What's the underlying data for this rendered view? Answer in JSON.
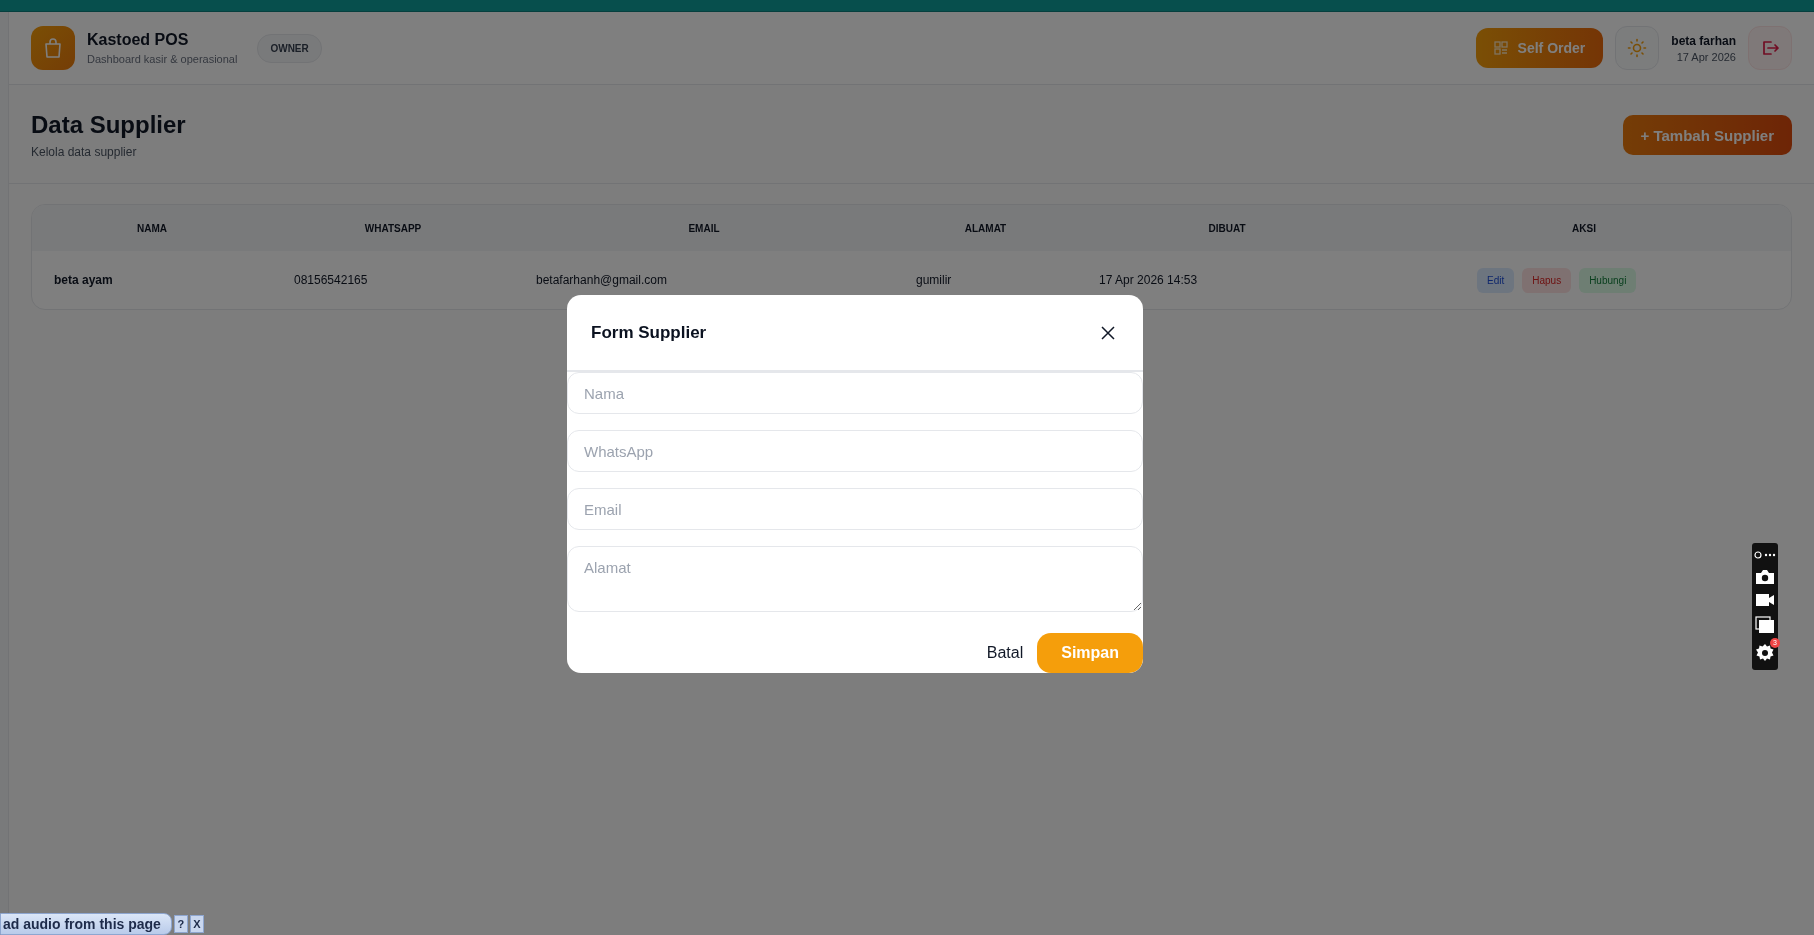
{
  "header": {
    "app_name": "Kastoed POS",
    "subtitle": "Dashboard kasir & operasional",
    "role_badge": "OWNER",
    "self_order_button": "Self Order",
    "user_name": "beta farhan",
    "date": "17 Apr 2026"
  },
  "page": {
    "title": "Data Supplier",
    "subtitle": "Kelola data supplier",
    "add_button": "+ Tambah Supplier"
  },
  "table": {
    "columns": [
      "NAMA",
      "WHATSAPP",
      "EMAIL",
      "ALAMAT",
      "DIBUAT",
      "AKSI"
    ],
    "rows": [
      {
        "nama": "beta ayam",
        "whatsapp": "08156542165",
        "email": "betafarhanh@gmail.com",
        "alamat": "gumilir",
        "dibuat": "17 Apr 2026 14:53",
        "actions": [
          {
            "label": "Edit",
            "kind": "edit"
          },
          {
            "label": "Hapus",
            "kind": "delete"
          },
          {
            "label": "Hubungi",
            "kind": "contact"
          }
        ]
      }
    ]
  },
  "modal": {
    "title": "Form Supplier",
    "fields": [
      {
        "placeholder": "Nama",
        "kind": "input"
      },
      {
        "placeholder": "WhatsApp",
        "kind": "input"
      },
      {
        "placeholder": "Email",
        "kind": "input"
      },
      {
        "placeholder": "Alamat",
        "kind": "textarea"
      }
    ],
    "cancel_button": "Batal",
    "save_button": "Simpan"
  },
  "screen_toolbar": {
    "badge": "3"
  },
  "audio_bar": {
    "text": "ad audio from this page",
    "help": "?",
    "close": "X"
  }
}
